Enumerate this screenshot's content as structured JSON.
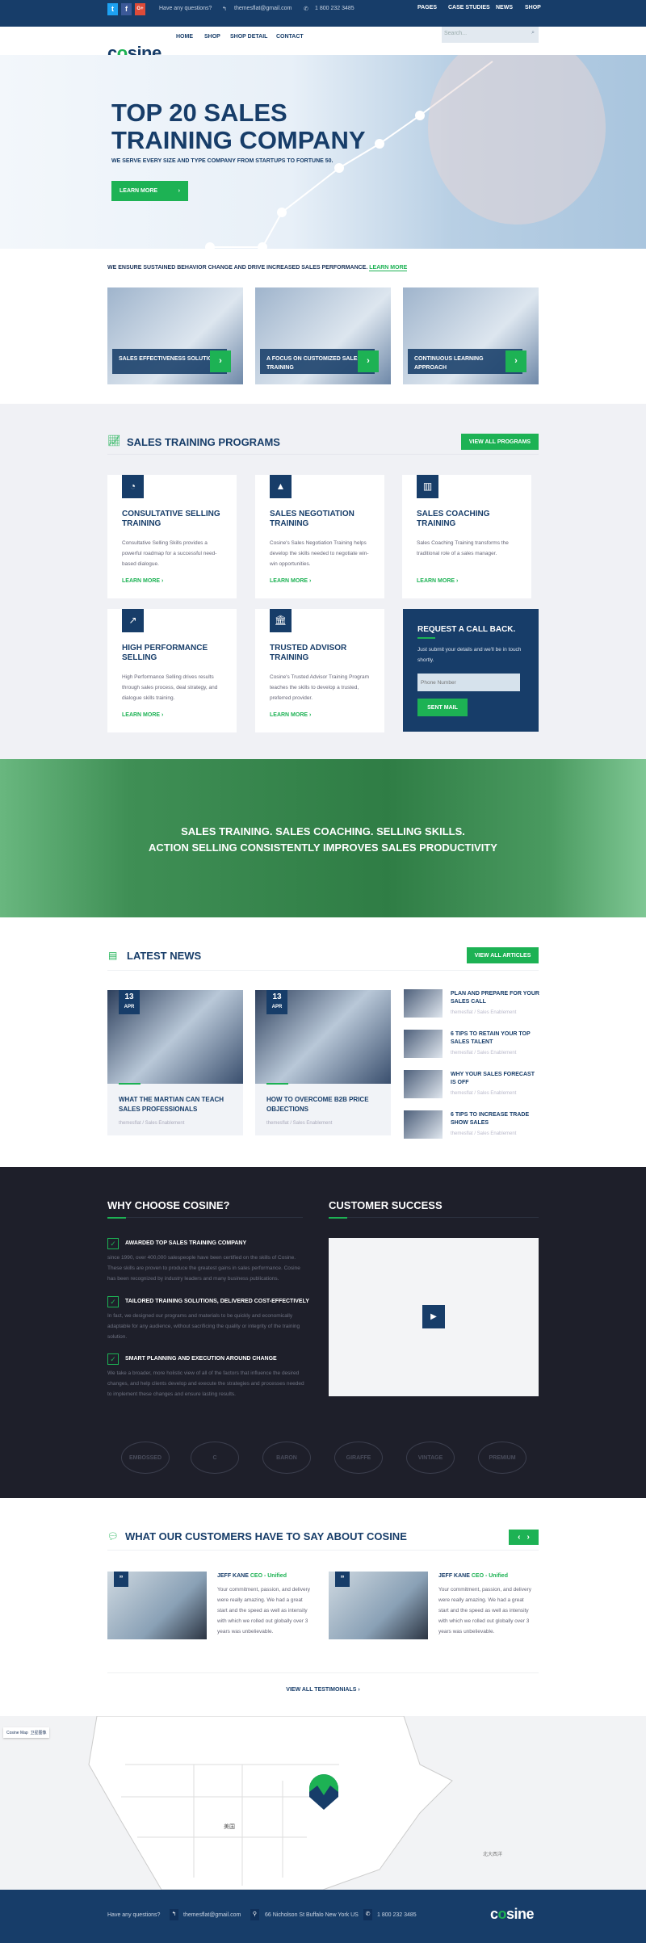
{
  "topbar": {
    "social": [
      "t",
      "f",
      "G+"
    ],
    "question": "Have any questions?",
    "email": "themesflat@gmail.com",
    "phone": "1 800 232 3485",
    "nav": [
      "PAGES",
      "CASE STUDIES",
      "NEWS",
      "SHOP"
    ]
  },
  "header": {
    "logo": "cosine",
    "nav": [
      "HOME",
      "SHOP",
      "SHOP DETAIL",
      "CONTACT"
    ],
    "search_placeholder": "Search..."
  },
  "hero": {
    "title_line1": "TOP 20 SALES",
    "title_line2": "TRAINING COMPANY",
    "subtitle": "WE SERVE EVERY SIZE AND TYPE COMPANY FROM STARTUPS TO FORTUNE 50.",
    "button": "LEARN MORE"
  },
  "tagline": {
    "text": "WE ENSURE SUSTAINED BEHAVIOR CHANGE AND DRIVE INCREASED SALES PERFORMANCE.",
    "link": "LEARN MORE"
  },
  "features": [
    "SALES EFFECTIVENESS SOLUTIONS",
    "A FOCUS ON CUSTOMIZED SALES TRAINING",
    "CONTINUOUS LEARNING APPROACH"
  ],
  "programs": {
    "title": "SALES TRAINING PROGRAMS",
    "view_all": "VIEW ALL PROGRAMS",
    "learn_more": "LEARN MORE",
    "items": [
      {
        "icon": "pie-chart-icon",
        "title": "CONSULTATIVE SELLING TRAINING",
        "desc": "Consultative Selling Skills provides a powerful roadmap for a successful need-based dialogue."
      },
      {
        "icon": "area-chart-icon",
        "title": "SALES NEGOTIATION TRAINING",
        "desc": "Cosine's Sales Negotiation Training helps develop the skills needed to negotiate win-win opportunities."
      },
      {
        "icon": "bar-chart-icon",
        "title": "SALES COACHING TRAINING",
        "desc": "Sales Coaching Training transforms the traditional role of a sales manager."
      },
      {
        "icon": "line-chart-icon",
        "title": "HIGH PERFORMANCE SELLING",
        "desc": "High Performance Selling drives results through sales process, deal strategy, and dialogue skills training."
      },
      {
        "icon": "bank-icon",
        "title": "TRUSTED ADVISOR TRAINING",
        "desc": "Cosine's Trusted Advisor Training Program teaches the skills to develop a trusted, preferred provider."
      }
    ],
    "callback": {
      "title": "REQUEST A CALL BACK.",
      "text": "Just submit your details and we'll be in touch shortly.",
      "placeholder": "Phone Number",
      "button": "SENT MAIL"
    }
  },
  "banner": {
    "line1": "SALES TRAINING. SALES COACHING. SELLING SKILLS.",
    "line2": "ACTION SELLING CONSISTENTLY IMPROVES SALES PRODUCTIVITY"
  },
  "news": {
    "title": "LATEST NEWS",
    "view_all": "VIEW ALL ARTICLES",
    "featured": [
      {
        "day": "13",
        "month": "APR",
        "title": "WHAT THE MARTIAN CAN TEACH SALES PROFESSIONALS",
        "meta": "themesflat / Sales Enablement"
      },
      {
        "day": "13",
        "month": "APR",
        "title": "HOW TO OVERCOME B2B PRICE OBJECTIONS",
        "meta": "themesflat / Sales Enablement"
      }
    ],
    "side": [
      {
        "title": "PLAN AND PREPARE FOR YOUR SALES CALL",
        "meta": "themesflat / Sales Enablement"
      },
      {
        "title": "6 TIPS TO RETAIN YOUR TOP SALES TALENT",
        "meta": "themesflat / Sales Enablement"
      },
      {
        "title": "WHY YOUR SALES FORECAST IS OFF",
        "meta": "themesflat / Sales Enablement"
      },
      {
        "title": "6 TIPS TO INCREASE TRADE SHOW SALES",
        "meta": "themesflat / Sales Enablement"
      }
    ]
  },
  "why": {
    "title": "WHY CHOOSE COSINE?",
    "items": [
      {
        "title": "AWARDED TOP SALES TRAINING COMPANY",
        "desc": "since 1990, over 400,000 salespeople have been certified on the skills of Cosine. These skills are proven to produce the greatest gains in sales performance. Cosine has been recognized by industry leaders and many business publications."
      },
      {
        "title": "TAILORED TRAINING SOLUTIONS, DELIVERED COST-EFFECTIVELY",
        "desc": "In fact, we designed our programs and materials to be quickly and economically adaptable for any audience, without sacrificing the quality or integrity of the training solution."
      },
      {
        "title": "SMART PLANNING AND EXECUTION AROUND CHANGE",
        "desc": "We take a broader, more holistic view of all of the factors that influence the desired changes, and help clients develop and execute the strategies and processes needed to implement these changes and ensure lasting results."
      }
    ]
  },
  "success": {
    "title": "CUSTOMER SUCCESS"
  },
  "brands": [
    "EMBOSSED",
    "C",
    "BARON",
    "GIRAFFE",
    "VINTAGE",
    "PREMIUM"
  ],
  "testimonials": {
    "title": "WHAT OUR CUSTOMERS HAVE TO SAY ABOUT COSINE",
    "view_all": "VIEW ALL TESTIMONIALS",
    "items": [
      {
        "name": "JEFF KANE",
        "role": "CEO - Unified",
        "text": "Your commitment, passion, and delivery were really amazing. We had a great start and the speed as well as intensity with which we rolled out globally over 3 years was unbelievable."
      },
      {
        "name": "JEFF KANE",
        "role": "CEO - Unified",
        "text": "Your commitment, passion, and delivery were really amazing. We had a great start and the speed as well as intensity with which we rolled out globally over 3 years was unbelievable."
      }
    ]
  },
  "map": {
    "tab1": "Cosine Map",
    "tab2": "卫星图像",
    "country": "美国",
    "ocean": "北大西洋"
  },
  "footer": {
    "question": "Have any questions?",
    "email": "themesflat@gmail.com",
    "address": "66 Nicholson St Buffalo New York US",
    "phone": "1 800 232 3485",
    "logo": "cosine"
  },
  "colors": {
    "navy": "#173d69",
    "green": "#1db254",
    "dark": "#1e1f2a"
  }
}
